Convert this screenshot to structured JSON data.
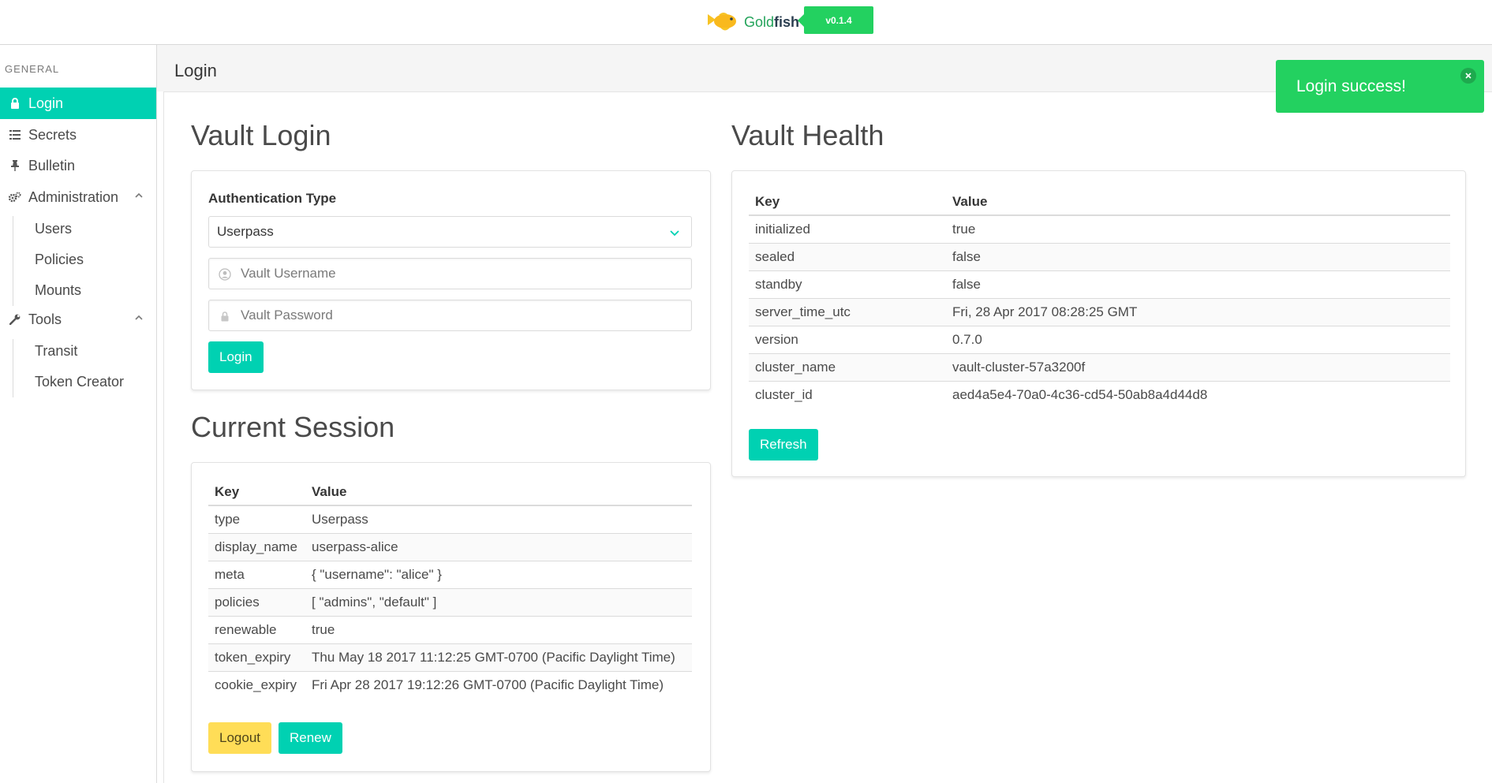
{
  "brand": {
    "name_part1": "Gold",
    "name_part2": "fish",
    "version": "v0.1.4"
  },
  "sidebar": {
    "section_label": "GENERAL",
    "items": [
      {
        "label": "Login",
        "icon": "lock-icon",
        "active": true
      },
      {
        "label": "Secrets",
        "icon": "list-icon"
      },
      {
        "label": "Bulletin",
        "icon": "pin-icon"
      },
      {
        "label": "Administration",
        "icon": "cogs-icon",
        "expanded": true
      },
      {
        "label": "Tools",
        "icon": "wrench-icon",
        "expanded": true
      }
    ],
    "admin_sub": [
      "Users",
      "Policies",
      "Mounts"
    ],
    "tools_sub": [
      "Transit",
      "Token Creator"
    ]
  },
  "page": {
    "title": "Login"
  },
  "vault_login": {
    "title": "Vault Login",
    "auth_type_label": "Authentication Type",
    "auth_type_value": "Userpass",
    "username_placeholder": "Vault Username",
    "password_placeholder": "Vault Password",
    "login_button": "Login"
  },
  "current_session": {
    "title": "Current Session",
    "col_key": "Key",
    "col_value": "Value",
    "rows": [
      {
        "key": "type",
        "value": "Userpass"
      },
      {
        "key": "display_name",
        "value": "userpass-alice"
      },
      {
        "key": "meta",
        "value": "{ \"username\": \"alice\" }"
      },
      {
        "key": "policies",
        "value": "[ \"admins\", \"default\" ]"
      },
      {
        "key": "renewable",
        "value": "true"
      },
      {
        "key": "token_expiry",
        "value": "Thu May 18 2017 11:12:25 GMT-0700 (Pacific Daylight Time)"
      },
      {
        "key": "cookie_expiry",
        "value": "Fri Apr 28 2017 19:12:26 GMT-0700 (Pacific Daylight Time)"
      }
    ],
    "logout_button": "Logout",
    "renew_button": "Renew"
  },
  "vault_health": {
    "title": "Vault Health",
    "col_key": "Key",
    "col_value": "Value",
    "rows": [
      {
        "key": "initialized",
        "value": "true"
      },
      {
        "key": "sealed",
        "value": "false"
      },
      {
        "key": "standby",
        "value": "false"
      },
      {
        "key": "server_time_utc",
        "value": "Fri, 28 Apr 2017 08:28:25 GMT"
      },
      {
        "key": "version",
        "value": "0.7.0"
      },
      {
        "key": "cluster_name",
        "value": "vault-cluster-57a3200f"
      },
      {
        "key": "cluster_id",
        "value": "aed4a5e4-70a0-4c36-cd54-50ab8a4d44d8"
      }
    ],
    "refresh_button": "Refresh"
  },
  "notification": {
    "message": "Login success!"
  },
  "colors": {
    "primary": "#00d1b2",
    "success": "#23d160",
    "warning": "#ffdd57"
  }
}
